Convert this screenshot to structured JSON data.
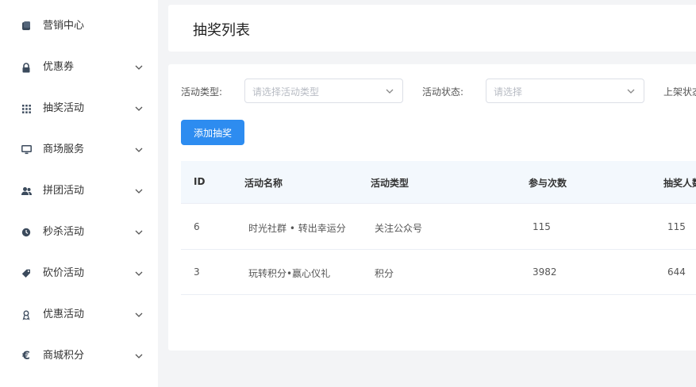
{
  "sidebar": {
    "items": [
      {
        "label": "营销中心",
        "icon": "square-stack-icon",
        "has_chevron": false
      },
      {
        "label": "优惠券",
        "icon": "lock-icon",
        "has_chevron": true
      },
      {
        "label": "抽奖活动",
        "icon": "grid-icon",
        "has_chevron": true
      },
      {
        "label": "商场服务",
        "icon": "monitor-icon",
        "has_chevron": true
      },
      {
        "label": "拼团活动",
        "icon": "users-icon",
        "has_chevron": true
      },
      {
        "label": "秒杀活动",
        "icon": "clock-icon",
        "has_chevron": true
      },
      {
        "label": "砍价活动",
        "icon": "tag-icon",
        "has_chevron": true
      },
      {
        "label": "优惠活动",
        "icon": "medal-icon",
        "has_chevron": true
      },
      {
        "label": "商城积分",
        "icon": "euro-icon",
        "has_chevron": true
      }
    ]
  },
  "header": {
    "title": "抽奖列表"
  },
  "filters": {
    "type_label": "活动类型:",
    "type_placeholder": "请选择活动类型",
    "status_label": "活动状态:",
    "status_placeholder": "请选择",
    "shelf_label": "上架状态"
  },
  "toolbar": {
    "add_label": "添加抽奖"
  },
  "table": {
    "headers": [
      "ID",
      "活动名称",
      "活动类型",
      "参与次数",
      "抽奖人数"
    ],
    "rows": [
      [
        "6",
        "时光社群 • 转出幸运分",
        "关注公众号",
        "115",
        "115"
      ],
      [
        "3",
        "玩转积分•赢心仪礼",
        "积分",
        "3982",
        "644"
      ]
    ]
  },
  "colors": {
    "accent": "#2d8cf0",
    "table_header_bg": "#f3f8fd",
    "page_bg": "#f3f4f6"
  }
}
